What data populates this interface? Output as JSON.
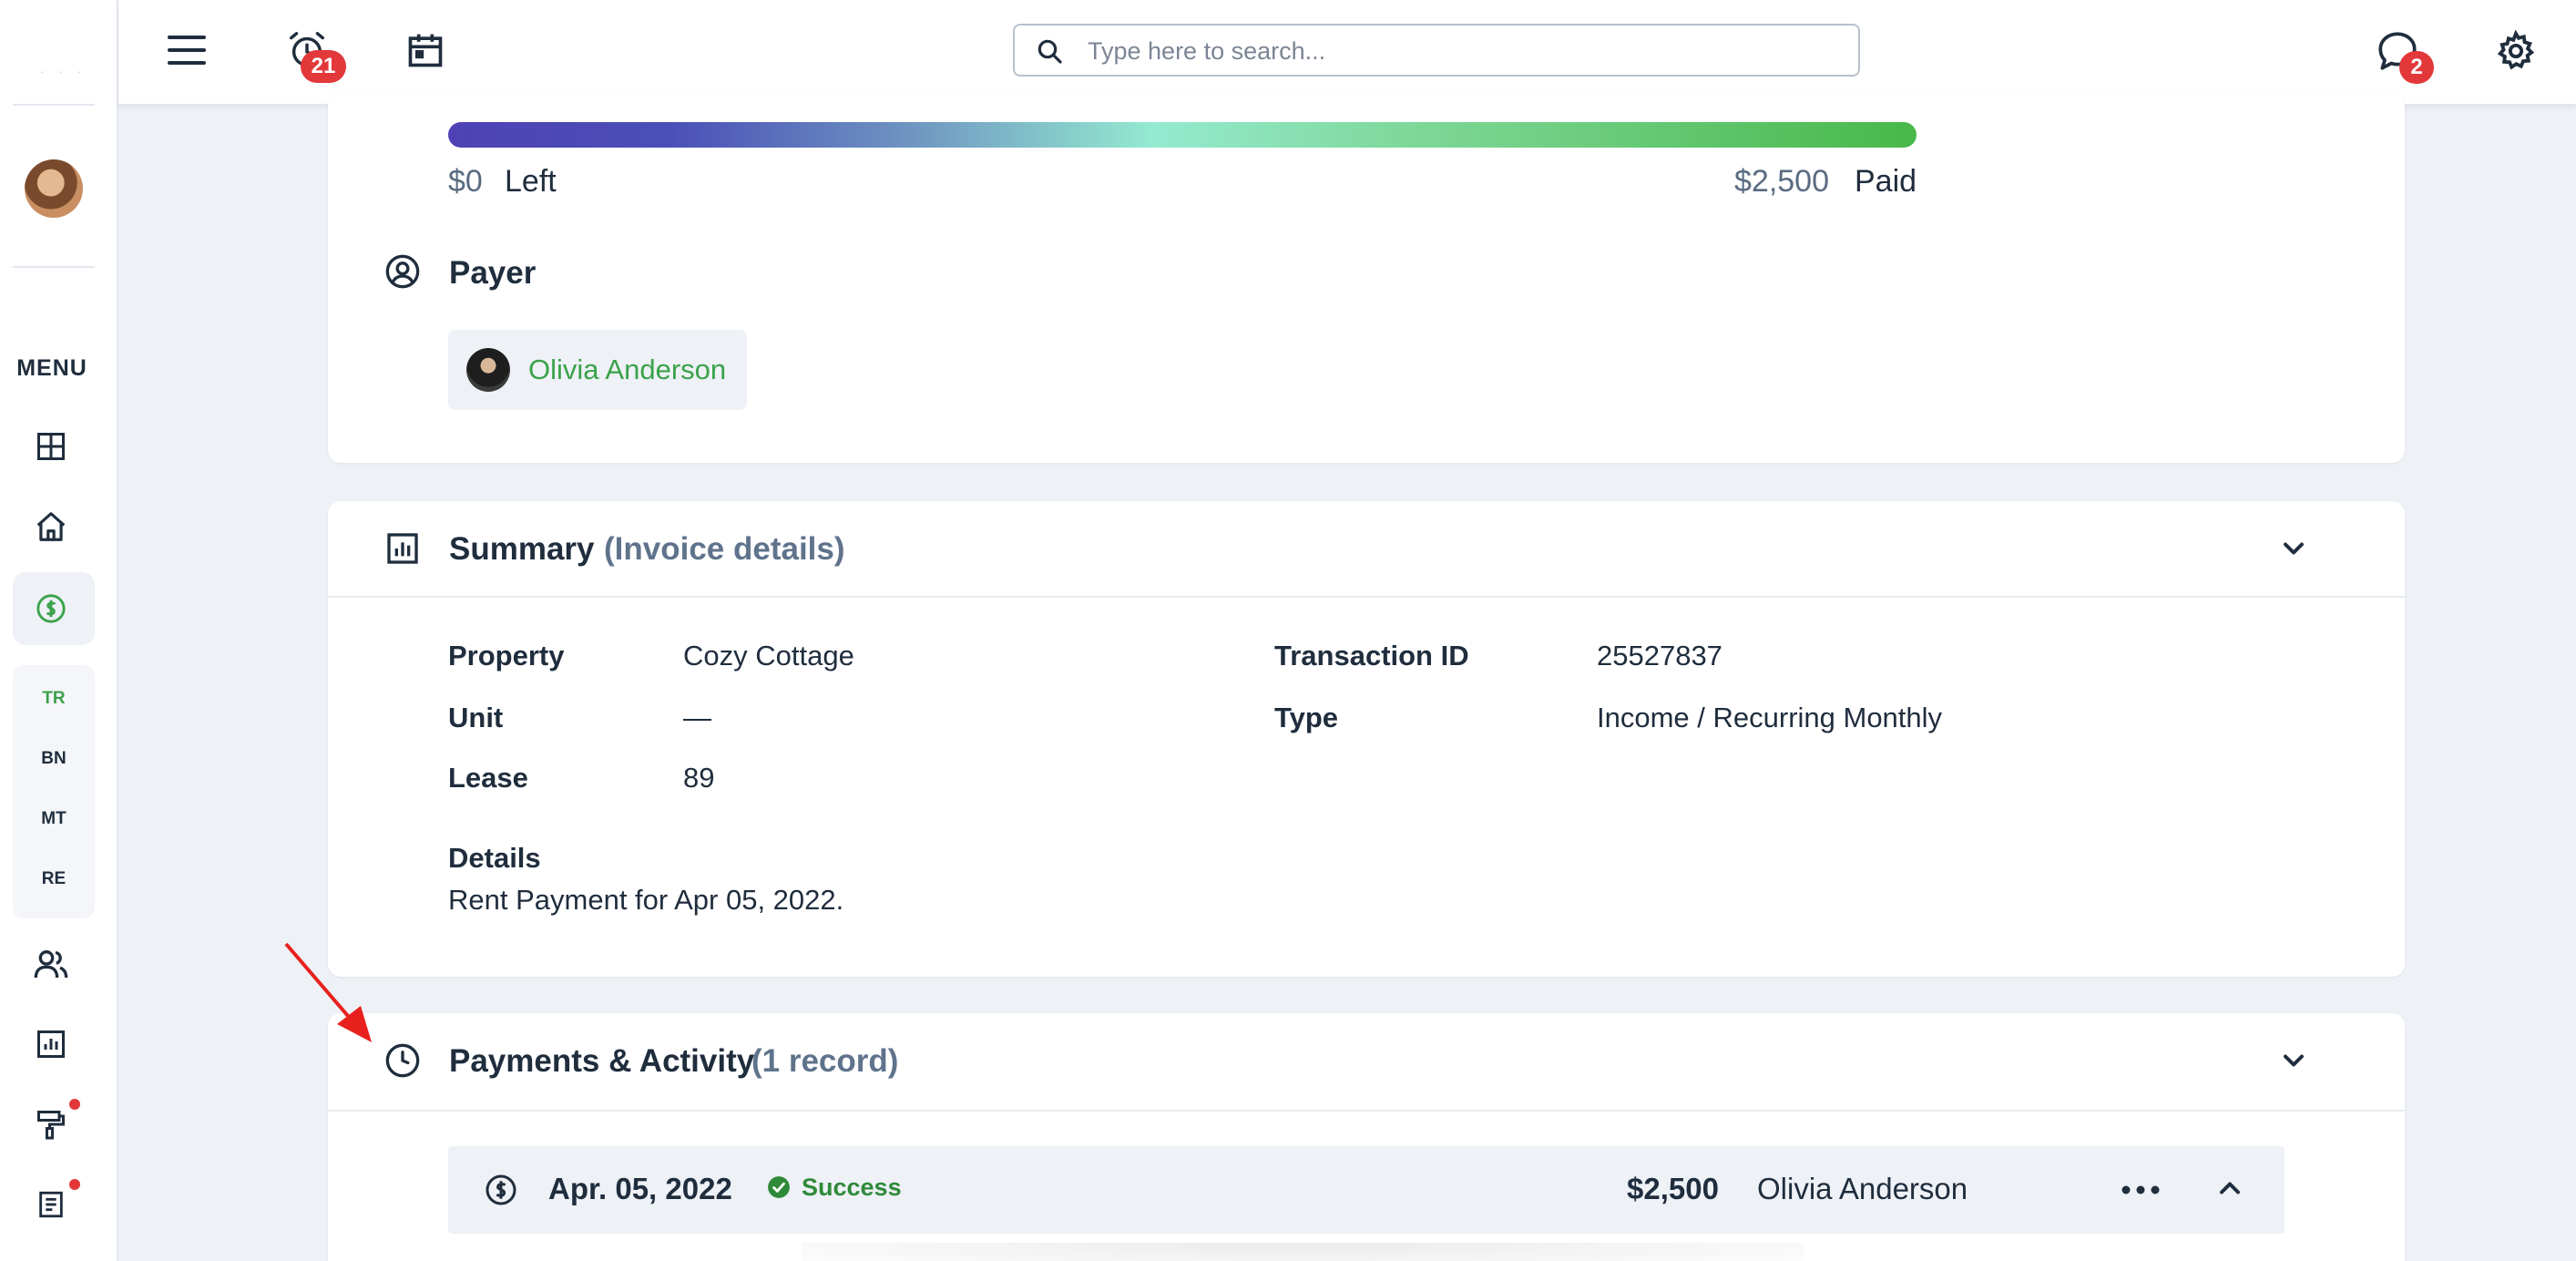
{
  "header": {
    "search_placeholder": "Type here to search...",
    "alerts_count": "21",
    "messages_count": "2"
  },
  "sidebar": {
    "menu_label": "MENU",
    "sub_items": [
      "TR",
      "BN",
      "MT",
      "RE"
    ],
    "active_sub_item": "TR"
  },
  "progress": {
    "paid_fraction": 1.0,
    "left_amount": "$0",
    "left_label": "Left",
    "paid_amount": "$2,500",
    "paid_label": "Paid"
  },
  "payer": {
    "title": "Payer",
    "name": "Olivia Anderson"
  },
  "summary": {
    "title": "Summary",
    "subtitle": "(Invoice details)",
    "fields": {
      "property_label": "Property",
      "property_value": "Cozy Cottage",
      "unit_label": "Unit",
      "unit_value": "—",
      "lease_label": "Lease",
      "lease_value": "89",
      "transaction_id_label": "Transaction ID",
      "transaction_id_value": "25527837",
      "type_label": "Type",
      "type_value": "Income / Recurring Monthly"
    },
    "details_label": "Details",
    "details_value": "Rent Payment for Apr 05, 2022."
  },
  "payments": {
    "title": "Payments & Activity",
    "subtitle": "(1 record)",
    "rows": [
      {
        "date": "Apr. 05, 2022",
        "status": "Success",
        "amount": "$2,500",
        "payer": "Olivia Anderson"
      }
    ]
  },
  "colors": {
    "accent_green": "#3aa24a",
    "badge_red": "#e2383a",
    "annotation_arrow": "#e8211f"
  }
}
